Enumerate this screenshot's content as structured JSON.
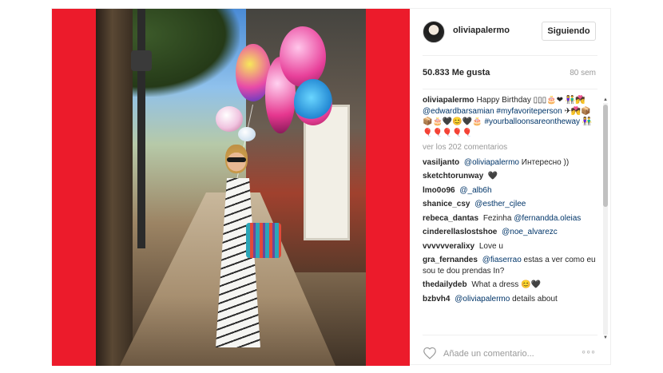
{
  "header": {
    "username": "oliviapalermo",
    "follow_label": "Siguiendo"
  },
  "stats": {
    "likes": "50.833 Me gusta",
    "time": "80 sem"
  },
  "caption": {
    "user": "oliviapalermo",
    "text1": "Happy Birthday ▯▯▯🎂❤",
    "text2": "👫💏",
    "mention": "@edwardbarsamian",
    "tag1": "#myfavoriteperson",
    "text3": "✈💏📦📦🎂🖤😊🖤🎂",
    "tag2": "#yourballoonsareontheway",
    "text4": "👫🎈🎈🎈🎈🎈"
  },
  "view_more": "ver los 202 comentarios",
  "comments": [
    {
      "user": "vasiljanto",
      "mention": "@oliviapalermo",
      "text": "Интересно ))"
    },
    {
      "user": "sketchtorunway",
      "mention": "",
      "text": "🖤"
    },
    {
      "user": "lmo0o96",
      "mention": "@_alb6h",
      "text": ""
    },
    {
      "user": "shanice_csy",
      "mention": "@esther_cjlee",
      "text": ""
    },
    {
      "user": "rebeca_dantas",
      "mention": "",
      "text": "Fezinha",
      "mention2": "@fernandda.oleias"
    },
    {
      "user": "cinderellaslostshoe",
      "mention": "@noe_alvarezc",
      "text": ""
    },
    {
      "user": "vvvvvveralixy",
      "mention": "",
      "text": "Love u"
    },
    {
      "user": "gra_fernandes",
      "mention": "@fiaserrao",
      "text": "estas a ver como eu sou te dou prendas In?"
    },
    {
      "user": "thedailydeb",
      "mention": "",
      "text": "What a dress 😊🖤"
    },
    {
      "user": "bzbvh4",
      "mention": "@oliviapalermo",
      "text": "details about"
    }
  ],
  "footer": {
    "comment_placeholder": "Añade un comentario...",
    "more_label": "◦◦◦"
  },
  "icons": {
    "heart": "heart-outline-icon",
    "more": "more-options-icon"
  },
  "colors": {
    "photo_border": "#ec1b2b",
    "link": "#003569",
    "muted": "#999999"
  }
}
